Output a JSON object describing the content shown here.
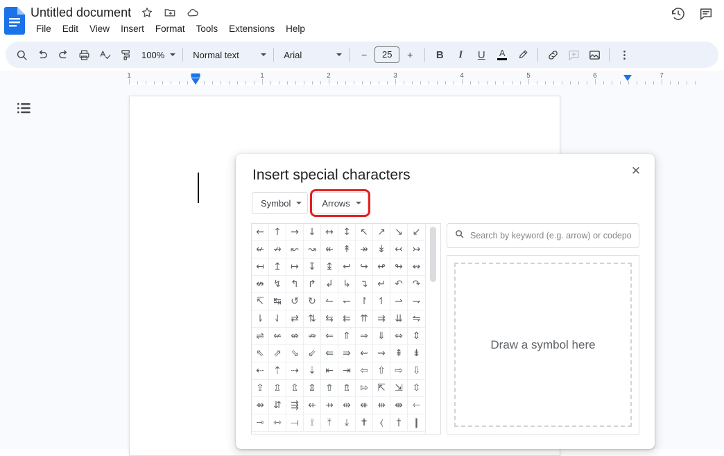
{
  "app": {
    "doc_title": "Untitled document",
    "title_icons": [
      "star-icon",
      "move-to-folder-icon",
      "cloud-saved-icon"
    ],
    "menus": [
      "File",
      "Edit",
      "View",
      "Insert",
      "Format",
      "Tools",
      "Extensions",
      "Help"
    ],
    "right_icons": [
      "version-history-icon",
      "comments-icon"
    ]
  },
  "toolbar": {
    "zoom": "100%",
    "paragraph_style": "Normal text",
    "font_family": "Arial",
    "font_size": "25",
    "decrease_label": "−",
    "increase_label": "+",
    "bold_label": "B",
    "italic_label": "I",
    "underline_label": "U",
    "text_color_label": "A",
    "icons": [
      "search-icon",
      "undo-icon",
      "redo-icon",
      "print-icon",
      "spelling-check-icon",
      "paint-format-icon",
      "highlight-pen-icon",
      "insert-link-icon",
      "add-comment-icon",
      "insert-image-icon",
      "more-options-icon"
    ]
  },
  "ruler": {
    "numbers": [
      "1",
      "1",
      "2",
      "3",
      "4",
      "5",
      "6",
      "7"
    ],
    "left_indent_position": "0.5",
    "right_margin_position": "6.5"
  },
  "canvas": {
    "outline_icon": "document-outline-icon"
  },
  "dialog": {
    "title": "Insert special characters",
    "close_label": "✕",
    "category_select": "Symbol",
    "subcategory_select": "Arrows",
    "subcategory_highlighted": true,
    "highlight_color": "#e02020",
    "search_placeholder": "Search by keyword (e.g. arrow) or codepoint",
    "search_value": "",
    "draw_area_label": "Draw a symbol here",
    "glyph_rows": [
      [
        "←",
        "↑",
        "→",
        "↓",
        "↔",
        "↕",
        "↖",
        "↗",
        "↘",
        "↙"
      ],
      [
        "↚",
        "↛",
        "↜",
        "↝",
        "↞",
        "↟",
        "↠",
        "↡",
        "↢",
        "↣"
      ],
      [
        "↤",
        "↥",
        "↦",
        "↧",
        "↨",
        "↩",
        "↪",
        "↫",
        "↬",
        "↭"
      ],
      [
        "↮",
        "↯",
        "↰",
        "↱",
        "↲",
        "↳",
        "↴",
        "↵",
        "↶",
        "↷"
      ],
      [
        "↸",
        "↹",
        "↺",
        "↻",
        "↼",
        "↽",
        "↾",
        "↿",
        "⇀",
        "⇁"
      ],
      [
        "⇂",
        "⇃",
        "⇄",
        "⇅",
        "⇆",
        "⇇",
        "⇈",
        "⇉",
        "⇊",
        "⇋"
      ],
      [
        "⇌",
        "⇍",
        "⇎",
        "⇏",
        "⇐",
        "⇑",
        "⇒",
        "⇓",
        "⇔",
        "⇕"
      ],
      [
        "⇖",
        "⇗",
        "⇘",
        "⇙",
        "⇚",
        "⇛",
        "⇜",
        "⇝",
        "⇞",
        "⇟"
      ],
      [
        "⇠",
        "⇡",
        "⇢",
        "⇣",
        "⇤",
        "⇥",
        "⇦",
        "⇧",
        "⇨",
        "⇩"
      ],
      [
        "⇪",
        "⇫",
        "⇬",
        "⇭",
        "⇮",
        "⇯",
        "⇰",
        "⇱",
        "⇲",
        "⇳"
      ],
      [
        "⇴",
        "⇵",
        "⇶",
        "⇷",
        "⇸",
        "⇹",
        "⇺",
        "⇻",
        "⇼",
        "⇽"
      ],
      [
        "⇾",
        "⇿",
        "⟞",
        "⟟",
        "⤒",
        "⤓",
        "✝",
        "⧼",
        "†",
        "❙"
      ]
    ]
  }
}
